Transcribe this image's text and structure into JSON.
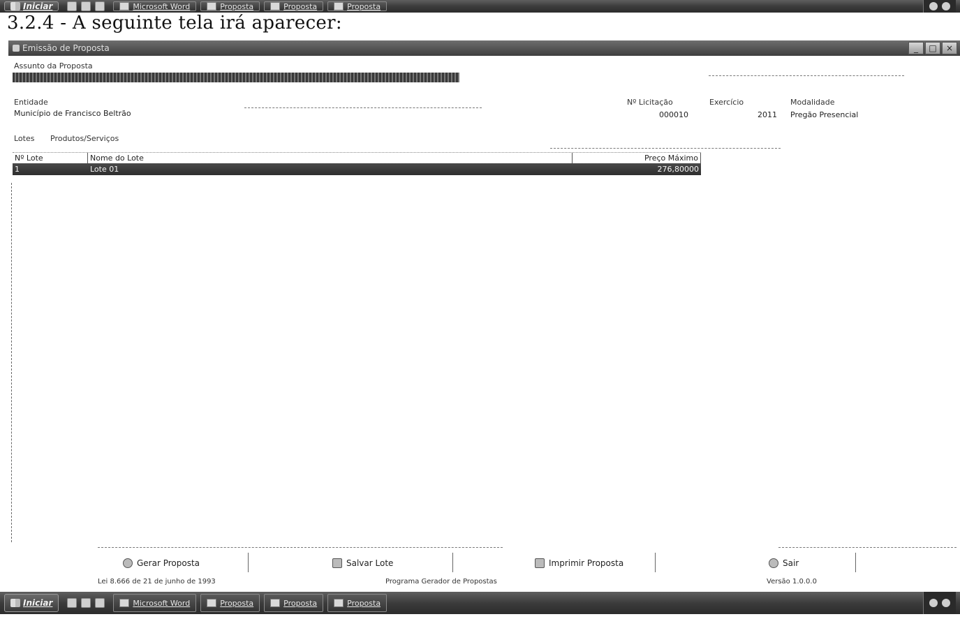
{
  "top_taskbar": {
    "start_label": "Iniciar",
    "tasks": [
      {
        "label": "Microsoft Word"
      },
      {
        "label": "Proposta"
      },
      {
        "label": "Proposta"
      },
      {
        "label": "Proposta"
      }
    ]
  },
  "caption": "3.2.4 - A seguinte tela irá aparecer:",
  "window": {
    "title": "Emissão de Proposta",
    "controls": [
      "_",
      "□",
      "×"
    ]
  },
  "form": {
    "subject_label": "Assunto da Proposta",
    "subject_value": "",
    "entity_label": "Entidade",
    "entity_value": "Município de Francisco Beltrão",
    "licitacao_label": "Nº Licitação",
    "licitacao_value": "000010",
    "exercicio_label": "Exercício",
    "exercicio_value": "2011",
    "modalidade_label": "Modalidade",
    "modalidade_value": "Pregão Presencial",
    "lotes_label": "Lotes",
    "lotes_tab": "Produtos/Serviços"
  },
  "lot_table": {
    "headers": [
      "Nº Lote",
      "Nome do Lote",
      "Preço Máximo"
    ],
    "rows": [
      {
        "numero": "1",
        "nome": "Lote 01",
        "preco": "276,80000"
      }
    ]
  },
  "buttons": {
    "gerar": "Gerar Proposta",
    "salvar": "Salvar Lote",
    "imprimir": "Imprimir Proposta",
    "sair": "Sair"
  },
  "status": {
    "left": "Lei 8.666 de 21 de junho de 1993",
    "center": "Programa Gerador de Propostas",
    "right": "Versão 1.0.0.0"
  },
  "bottom_taskbar": {
    "start_label": "Iniciar",
    "tasks": [
      {
        "label": "Microsoft Word"
      },
      {
        "label": "Proposta"
      },
      {
        "label": "Proposta"
      },
      {
        "label": "Proposta"
      }
    ]
  }
}
